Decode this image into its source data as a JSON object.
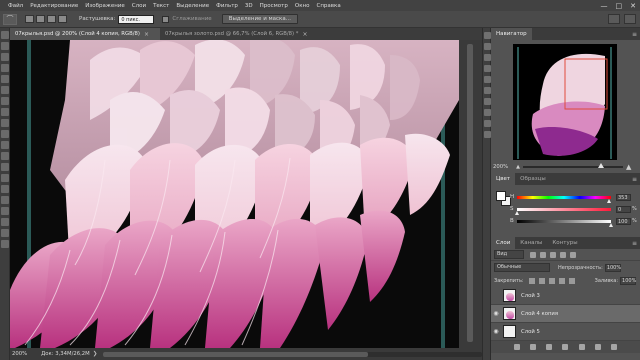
{
  "menu": [
    "Файл",
    "Редактирование",
    "Изображение",
    "Слои",
    "Текст",
    "Выделение",
    "Фильтр",
    "3D",
    "Просмотр",
    "Окно",
    "Справка"
  ],
  "window_controls": {
    "minimize": "—",
    "maximize": "□",
    "close": "✕"
  },
  "options_bar": {
    "feather_label": "Растушевка:",
    "feather_value": "0 пикс.",
    "antialias_label": "Сглаживание",
    "select_mask_label": "Выделение и маска..."
  },
  "tabs": [
    {
      "label": "07крылья.psd @ 200% (Слой 4 копия, RGB/8)",
      "close": "×"
    },
    {
      "label": "07крылья золото.psd @ 66,7% (Слой 6, RGB/8) *",
      "close": "×"
    }
  ],
  "status": {
    "zoom": "200%",
    "doc": "Док: 3,34M/26,2M",
    "arrow": "❯"
  },
  "navigator": {
    "title": "Навигатор",
    "zoom": "200%",
    "zoom_fraction": 0.78
  },
  "color_panel": {
    "tabs": [
      "Цвет",
      "Образцы"
    ],
    "foreground": "#ffffff",
    "background": "#f2f2f2",
    "hsb": [
      {
        "label": "H",
        "value": "353",
        "unit": "",
        "fraction": 0.98
      },
      {
        "label": "S",
        "value": "0",
        "unit": "%",
        "fraction": 0.0
      },
      {
        "label": "B",
        "value": "100",
        "unit": "%",
        "fraction": 1.0
      }
    ]
  },
  "layers_panel": {
    "tabs": [
      "Слои",
      "Каналы",
      "Контуры"
    ],
    "kind_filter": "Вид",
    "blend_mode": "Обычные",
    "opacity_label": "Непрозрачность:",
    "opacity_value": "100%",
    "lock_label": "Закрепить:",
    "fill_label": "Заливка:",
    "fill_value": "100%",
    "layers": [
      {
        "name": "Слой 3",
        "visible": false,
        "selected": false
      },
      {
        "name": "Слой 4 копия",
        "visible": true,
        "selected": true
      },
      {
        "name": "Слой 5",
        "visible": true,
        "selected": false
      }
    ]
  },
  "colors": {
    "accent": "#e9a8c4",
    "feather_deep": "#b8327f",
    "canvas_bg": "#0a0a0a",
    "guide": "#2b5a57"
  }
}
